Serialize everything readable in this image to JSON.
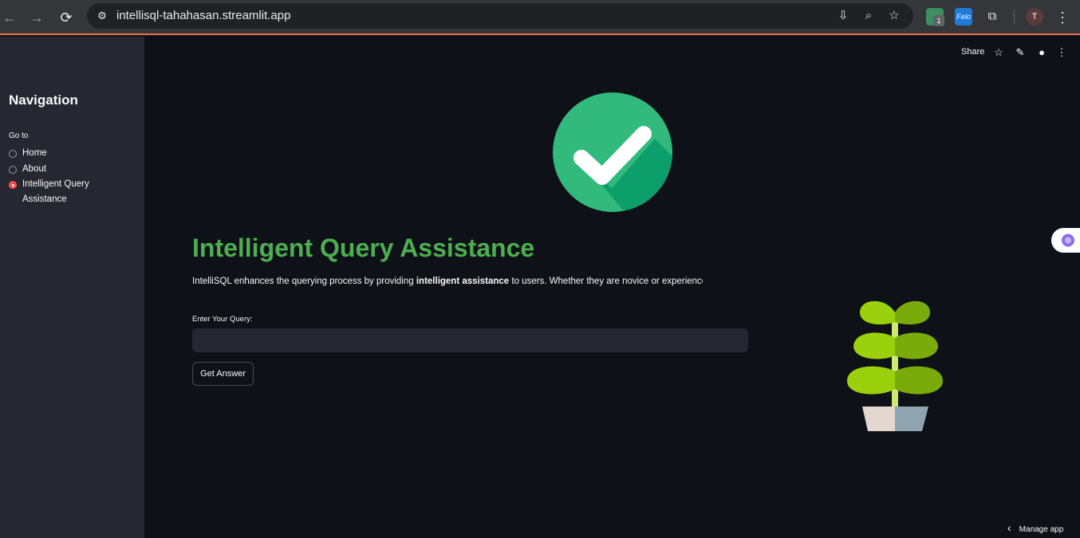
{
  "browser": {
    "url": "intellisql-tahahasan.streamlit.app",
    "back_icon": "←",
    "forward_icon": "→",
    "reload_icon": "⟳",
    "site_info_icon": "⚙",
    "install_icon": "⇩",
    "zoom_icon": "⌕",
    "bookmark_icon": "☆",
    "ext1_badge": "1",
    "ext2_label": "Felo",
    "extensions_icon": "⧉",
    "avatar_initial": "T",
    "menu_icon": "⋮"
  },
  "sidebar": {
    "title": "Navigation",
    "radio_label": "Go to",
    "options": [
      {
        "label": "Home",
        "selected": false
      },
      {
        "label": "About",
        "selected": false
      },
      {
        "label": "Intelligent Query Assistance",
        "selected": true
      }
    ]
  },
  "toolbar": {
    "share_label": "Share",
    "star_icon": "☆",
    "edit_icon": "✎",
    "github_icon": "●",
    "more_icon": "⋮"
  },
  "main": {
    "title": "Intelligent Query Assistance",
    "desc_before": "IntelliSQL enhances the querying process by providing ",
    "desc_bold": "intelligent assistance",
    "desc_after": " to users. Whether they are novice or experienced S",
    "query_label": "Enter Your Query:",
    "query_value": "",
    "button_label": "Get Answer"
  },
  "footer": {
    "manage_label": "Manage app",
    "chevron": "‹"
  },
  "colors": {
    "accent": "#ff4b4b",
    "title_green": "#4caf50",
    "background": "#0e1117",
    "sidebar": "#262730"
  }
}
